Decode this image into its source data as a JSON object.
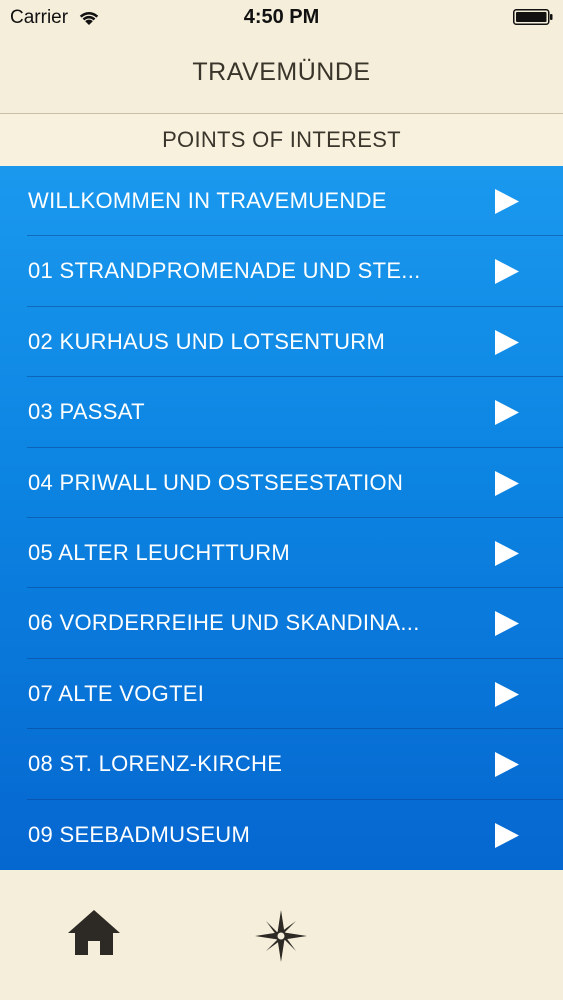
{
  "status_bar": {
    "carrier": "Carrier",
    "time": "4:50 PM"
  },
  "nav": {
    "title": "TRAVEMÜNDE"
  },
  "section": {
    "title": "POINTS OF INTEREST"
  },
  "list": {
    "items": [
      {
        "label": "WILLKOMMEN IN TRAVEMUENDE"
      },
      {
        "label": "01 STRANDPROMENADE UND STE..."
      },
      {
        "label": "02 KURHAUS UND LOTSENTURM"
      },
      {
        "label": "03 PASSAT"
      },
      {
        "label": "04 PRIWALL UND OSTSEESTATION"
      },
      {
        "label": "05 ALTER LEUCHTTURM"
      },
      {
        "label": "06 VORDERREIHE UND SKANDINA..."
      },
      {
        "label": "07 ALTE VOGTEI"
      },
      {
        "label": "08 ST. LORENZ-KIRCHE"
      },
      {
        "label": "09 SEEBADMUSEUM"
      }
    ]
  },
  "tab_bar": {
    "tabs": [
      {
        "icon": "home-icon"
      },
      {
        "icon": "compass-rose-icon"
      }
    ]
  },
  "colors": {
    "cream": "#f5eedb",
    "list_blue_top": "#1a98ee",
    "list_blue_bottom": "#0567d0",
    "title_text": "#3a352b",
    "icon_dark": "#2d2a25"
  }
}
